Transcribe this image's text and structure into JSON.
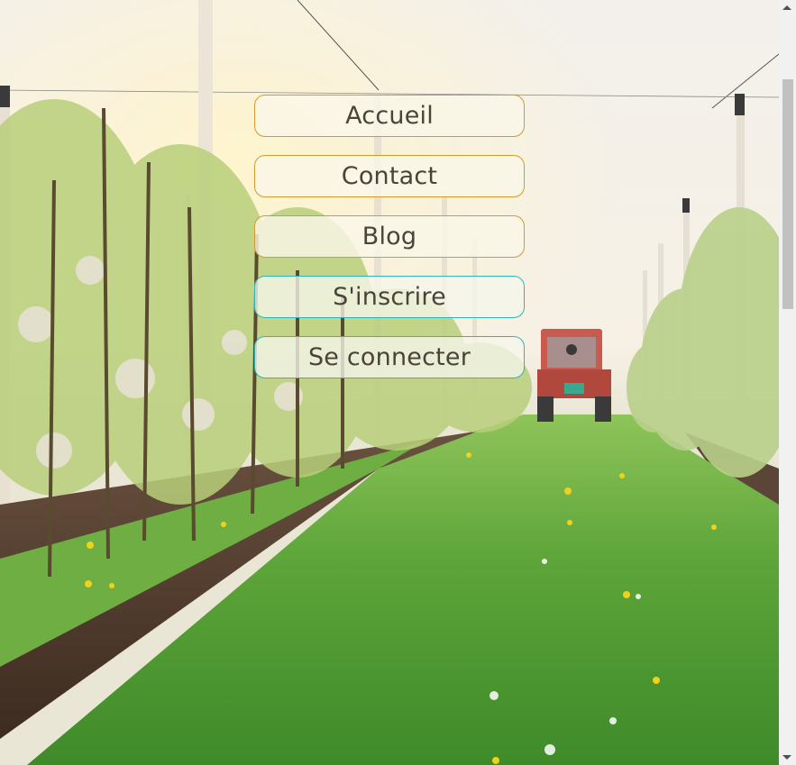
{
  "background": {
    "scene": "orchard-with-tractor"
  },
  "menu": {
    "items": [
      {
        "label": "Accueil"
      },
      {
        "label": "Contact"
      },
      {
        "label": "Blog"
      },
      {
        "label": "S'inscrire"
      },
      {
        "label": "Se connecter"
      }
    ]
  },
  "colors": {
    "border_gold": "#d39a2c",
    "border_teal": "#2fb5b9",
    "text": "#4a4438"
  }
}
